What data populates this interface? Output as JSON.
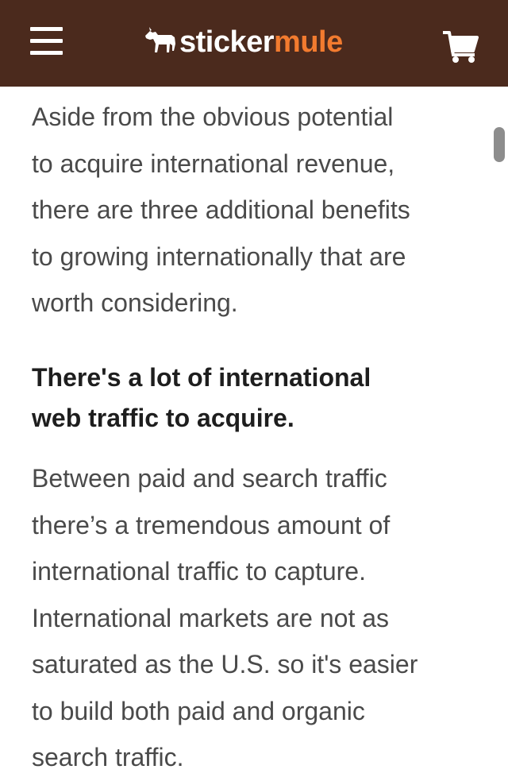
{
  "header": {
    "logo_primary": "sticker",
    "logo_accent": "mule",
    "background_color": "#4b2a1d",
    "accent_color": "#f27b2f",
    "menu_icon": "hamburger-menu-icon",
    "cart_icon": "shopping-cart-icon"
  },
  "article": {
    "intro_lines": [
      "Aside from the obvious potential",
      "to acquire international revenue,",
      "there are three additional benefits",
      "to growing internationally that are",
      "worth considering."
    ],
    "heading_lines": [
      "There's a lot of international",
      "web traffic to acquire."
    ],
    "body_lines": [
      "Between paid and search traffic",
      "there’s a tremendous amount of",
      "international traffic to capture.",
      "International markets are not as",
      "saturated as the U.S. so it's easier",
      "to build both paid and organic",
      "search traffic."
    ]
  }
}
